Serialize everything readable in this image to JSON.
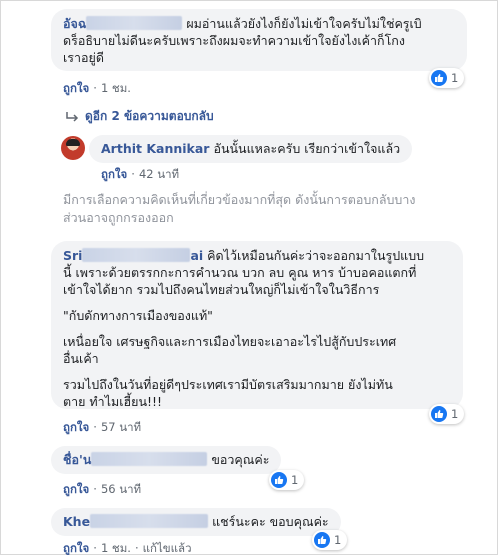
{
  "comments": [
    {
      "name_visible": "อัจฉ",
      "lines": [
        "ผมอ่านแล้วยังไงก็ยังไม่เข้าใจครับไม่ใช่ครูเบิ",
        "ดร็อธิบายไม่ดีนะครับเพราะถึงผมจะทำความเข้าใจยังไงเค้าก็โกง",
        "เราอยู่ดี"
      ],
      "reactions": "1",
      "like": "ถูกใจ",
      "time": "1 ชม."
    },
    {
      "name_visible": "Sri",
      "name_tail": "ai",
      "lines": [
        "คิดไว้เหมือนกันค่ะว่าจะออกมาในรูปแบบ",
        "นี้ เพราะด้วยตรรกกะการคำนวณ บวก ลบ คูณ หาร บ้าบอคอแตกที่",
        "เข้าใจได้ยาก รวมไปถึงคนไทยส่วนใหญ่ก็ไม่เข้าใจในวิธีการ"
      ],
      "quote": "\"กับดักทางการเมืองของแท้\"",
      "para2": [
        "เหนื่อยใจ เศรษฐกิจและการเมืองไทยจะเอาอะไรไปสู้กับประเทศ",
        "อื่นเค้า"
      ],
      "para3": [
        "รวมไปถึงในวันที่อยู่ดีๆประเทศเรามีบัตรเสริมมากมาย ยังไม่ทัน",
        "ตาย ทำไมเฮี้ยน!!!"
      ],
      "reactions": "1",
      "like": "ถูกใจ",
      "time": "57 นาที"
    },
    {
      "name_visible": "ชื่อ'น",
      "text": "ขอวคุณค่ะ",
      "reactions": "1",
      "like": "ถูกใจ",
      "time": "56 นาที"
    },
    {
      "name_visible": "Khe",
      "text": "แชร์นะคะ ขอบคุณค่ะ",
      "reactions": "1",
      "like": "ถูกใจ",
      "time": "1 ชม.",
      "edited": "แก้ไขแล้ว"
    }
  ],
  "replies_link": "ดูอีก 2 ข้อความตอบกลับ",
  "reply": {
    "name": "Arthit Kannikar",
    "text": "อันนั้นแหละครับ เรียกว่าเข้าใจแล้ว",
    "like": "ถูกใจ",
    "time": "42 นาที"
  },
  "notice_lines": [
    "มีการเลือกความคิดเห็นที่เกี่ยวข้องมากที่สุด ดังนั้นการตอบกลับบาง",
    "ส่วนอาจถูกกรองออก"
  ],
  "colors": {
    "name": "#385898",
    "bubble": "#f2f3f5",
    "like_icon": "#1877f2",
    "meta": "#606770"
  },
  "icons": [
    "like-icon",
    "reply-arrow-icon"
  ]
}
